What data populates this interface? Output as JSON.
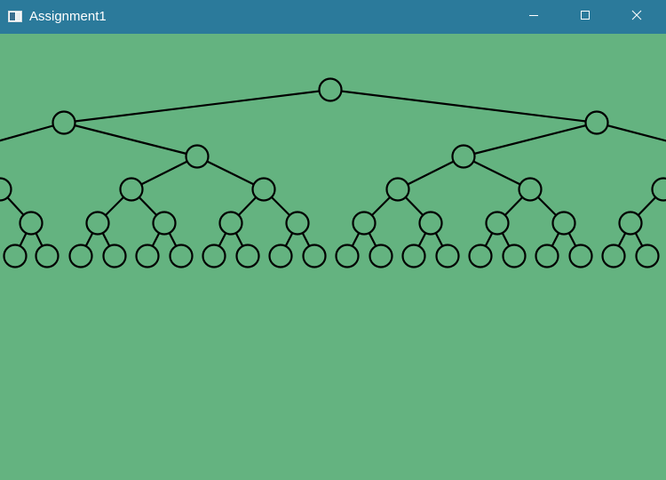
{
  "window": {
    "title": "Assignment1",
    "titlebar_color": "#2b7a9b",
    "background_color": "#64b380",
    "stroke_color": "#000000"
  },
  "icons": {
    "app": "app-window-icon",
    "minimize": "minimize-icon",
    "maximize": "maximize-icon",
    "close": "close-icon"
  },
  "tree": {
    "node_count": 40,
    "edge_count": 39
  }
}
